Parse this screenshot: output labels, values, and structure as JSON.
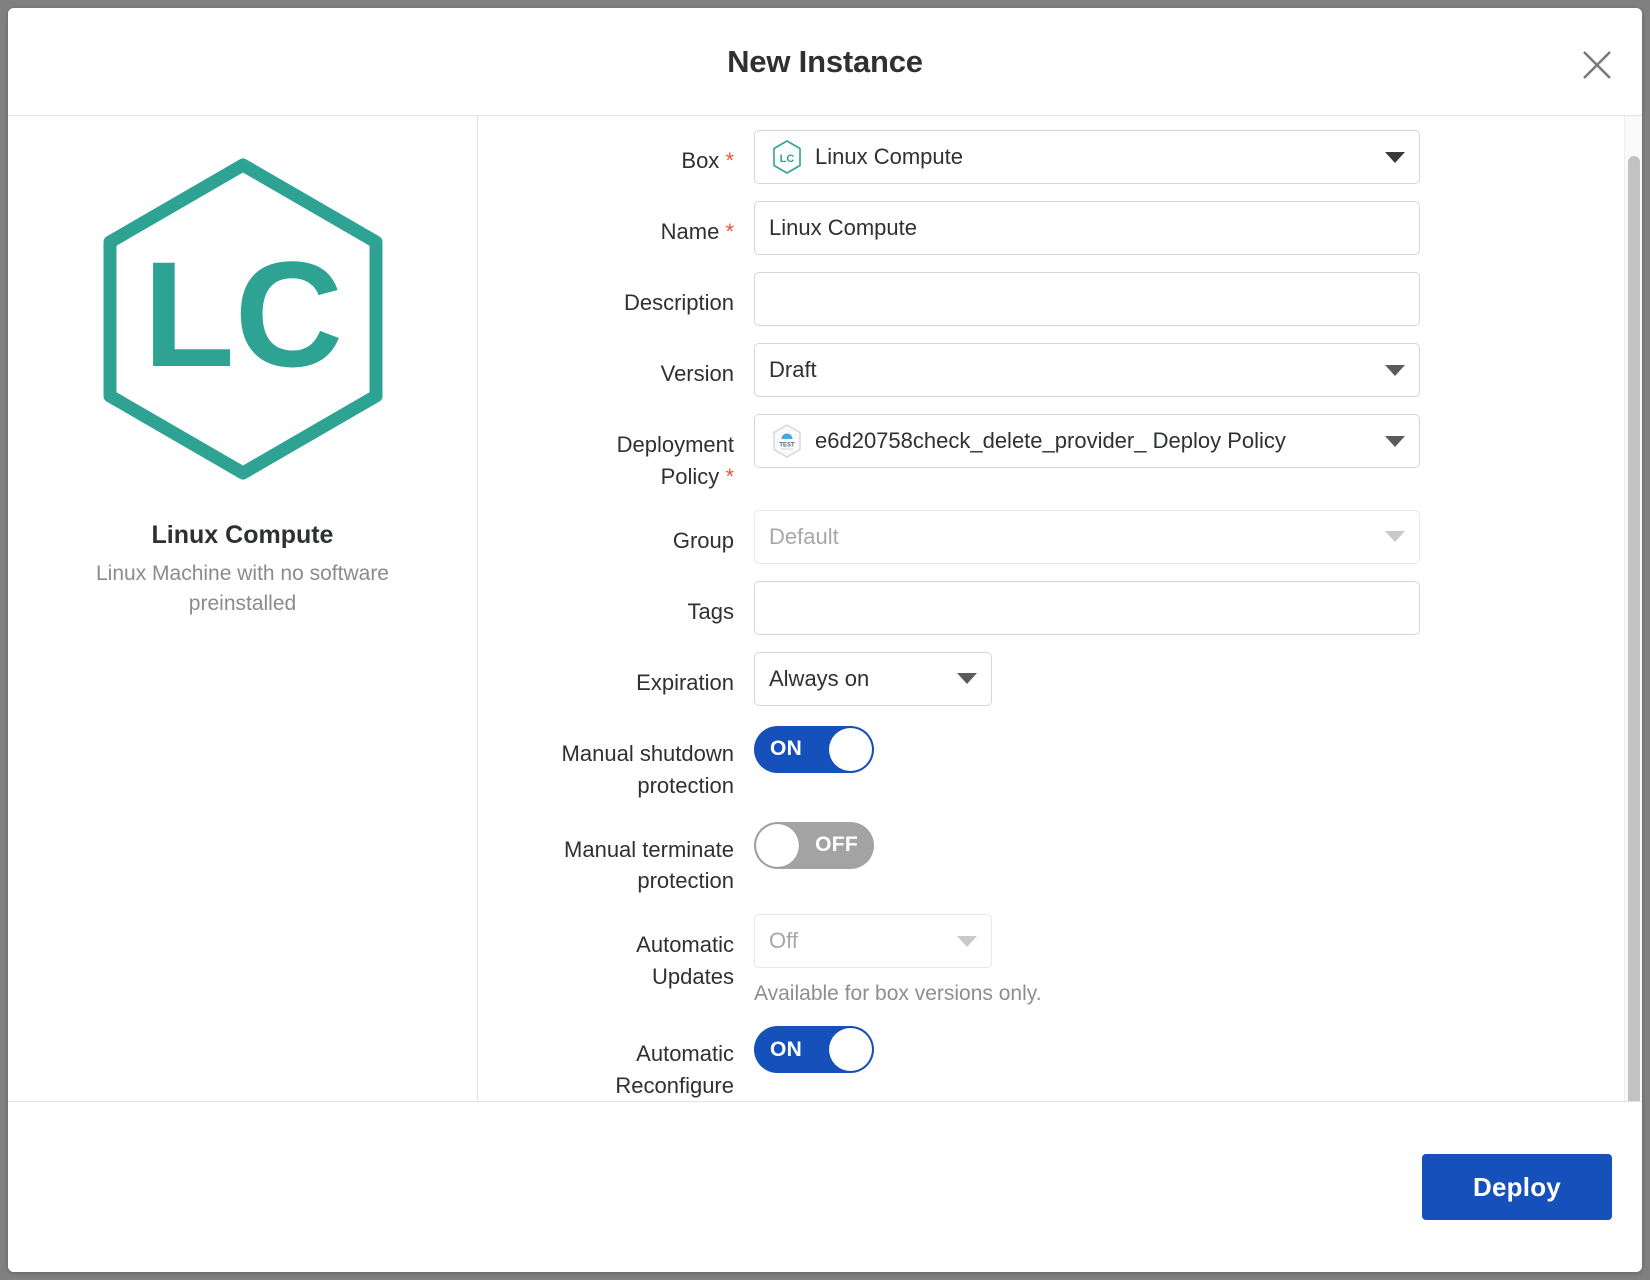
{
  "dialog": {
    "title": "New Instance",
    "close_icon": "close-icon"
  },
  "box_preview": {
    "logo_initials": "LC",
    "name": "Linux Compute",
    "description": "Linux Machine with no software preinstalled",
    "logo_color": "#2fa393"
  },
  "form": {
    "box": {
      "label": "Box",
      "required": "*",
      "value": "Linux Compute",
      "icon": "linux-compute-hex-icon"
    },
    "name": {
      "label": "Name",
      "required": "*",
      "value": "Linux Compute"
    },
    "description": {
      "label": "Description",
      "value": "",
      "placeholder": ""
    },
    "version": {
      "label": "Version",
      "value": "Draft"
    },
    "deployment_policy": {
      "label_line1": "Deployment",
      "label_line2": "Policy",
      "required": "*",
      "value": "e6d20758check_delete_provider_ Deploy Policy",
      "icon": "test-policy-hex-icon"
    },
    "group": {
      "label": "Group",
      "placeholder": "Default",
      "value": ""
    },
    "tags": {
      "label": "Tags",
      "value": "",
      "placeholder": ""
    },
    "expiration": {
      "label": "Expiration",
      "value": "Always on"
    },
    "manual_shutdown_protection": {
      "label_line1": "Manual shutdown",
      "label_line2": "protection",
      "state": "ON"
    },
    "manual_terminate_protection": {
      "label_line1": "Manual terminate",
      "label_line2": "protection",
      "state": "OFF"
    },
    "automatic_updates": {
      "label_line1": "Automatic",
      "label_line2": "Updates",
      "placeholder": "Off",
      "hint": "Available for box versions only."
    },
    "automatic_reconfigure": {
      "label_line1": "Automatic",
      "label_line2": "Reconfigure",
      "state": "ON"
    }
  },
  "footer": {
    "deploy_label": "Deploy"
  },
  "colors": {
    "primary_blue": "#1650ba",
    "teal": "#2fa393",
    "required_red": "#e8573f",
    "toggle_off_gray": "#a3a3a3"
  }
}
